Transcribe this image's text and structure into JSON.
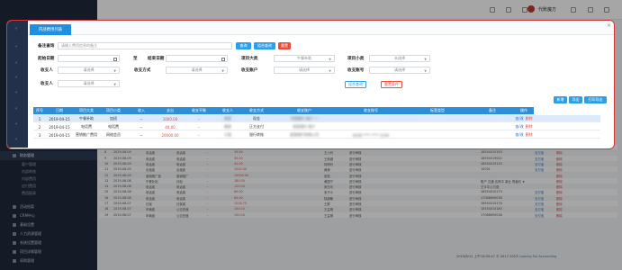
{
  "sidebar": {
    "section_title": "财务管理",
    "items": [
      {
        "label": "客户管理"
      },
      {
        "label": "内部转账"
      },
      {
        "label": "内部费用"
      },
      {
        "label": "应付费用"
      },
      {
        "label": "费用报表"
      }
    ],
    "groups": [
      {
        "label": "活动档案"
      },
      {
        "label": "CRM中心"
      },
      {
        "label": "基础设置"
      },
      {
        "label": "人力资源管理"
      },
      {
        "label": "系统设置管理"
      },
      {
        "label": "项目详情管理"
      },
      {
        "label": "采购管理"
      }
    ]
  },
  "topbar": {
    "user_name": "代账魔方"
  },
  "background_table": {
    "rows": [
      {
        "no": "7",
        "date": "2019-08-09",
        "type": "电话费",
        "item": "电话费",
        "amount": "-",
        "amount2": "32.00",
        "person": "李明",
        "status": "进行审核",
        "phone": "18554010239",
        "pay": "支付宝"
      },
      {
        "no": "8",
        "date": "2019-08-09",
        "type": "电话费",
        "item": "电话费",
        "amount": "-",
        "amount2": "39.89",
        "person": "王小玲",
        "status": "进行审核",
        "phone": "18554010193",
        "pay": "支付宝"
      },
      {
        "no": "9",
        "date": "2019-08-09",
        "type": "电话费",
        "item": "电话费",
        "amount": "-",
        "amount2": "30.00",
        "person": "王和健",
        "status": "进行审核",
        "phone": "18554019002",
        "pay": "支付宝"
      },
      {
        "no": "10",
        "date": "2019-08-09",
        "type": "电话费",
        "item": "电话费",
        "amount": "-",
        "amount2": "42.00",
        "person": "何琼玲",
        "status": "进行审核",
        "phone": "18554019133",
        "pay": "支付宝"
      },
      {
        "no": "11",
        "date": "2019-08-09",
        "type": "出租费",
        "item": "出租费",
        "amount": "-",
        "amount2": "1000.00",
        "person": "黄美",
        "status": "进行审核",
        "phone": "10031",
        "pay": "支付宝"
      },
      {
        "no": "12",
        "date": "2019-08-09",
        "type": "营销推广费",
        "item": "营销推广",
        "amount": "-",
        "amount2": "10000.00",
        "person": "张笑",
        "status": "进行审核",
        "phone": "",
        "pay": ""
      },
      {
        "no": "13",
        "date": "2019-08-08",
        "type": "午餐补贴",
        "item": "补贴",
        "amount": "-",
        "amount2": "180.00",
        "person": "黄国宁",
        "status": "进行审核",
        "phone": "账户 交通 名称中 事业 再营约 ★",
        "pay": ""
      },
      {
        "no": "14",
        "date": "2019-08-08",
        "type": "电话费",
        "item": "电话费",
        "amount": "-",
        "amount2": "120.00",
        "person": "张乐乐",
        "status": "进行审核",
        "phone": "王宇中心付费",
        "pay": ""
      },
      {
        "no": "15",
        "date": "2019-08-08",
        "type": "电话费",
        "item": "电话费",
        "amount": "-",
        "amount2": "60.00",
        "person": "宋子小",
        "status": "进行审核",
        "phone": "18554010179",
        "pay": "支付宝"
      },
      {
        "no": "16",
        "date": "2019-08-08",
        "type": "电话费",
        "item": "电话费",
        "amount": "-",
        "amount2": "60.00",
        "person": "陆超敏",
        "status": "进行审核",
        "phone": "17088690038",
        "pay": "支付宝"
      },
      {
        "no": "17",
        "date": "2019-08-07",
        "type": "社保",
        "item": "社保费",
        "amount": "-",
        "amount2": "1218.75",
        "person": "王群",
        "status": "进行审核",
        "phone": "18554010176",
        "pay": "支付宝"
      },
      {
        "no": "18",
        "date": "2019-08-07",
        "type": "车辆费",
        "item": "公交充值",
        "amount": "-",
        "amount2": "100.00",
        "person": "王益明",
        "status": "进行审核",
        "phone": "18554010180",
        "pay": "支付宝"
      },
      {
        "no": "19",
        "date": "2019-08-07",
        "type": "车辆费",
        "item": "公交充值",
        "amount": "-",
        "amount2": "100.00",
        "person": "王益明",
        "status": "进行审核",
        "phone": "17088690038",
        "pay": "支付宝"
      }
    ]
  },
  "footer": {
    "prefix": "2019/8/12 上午10:05:47 © 2017-2023 ",
    "highlight": "Looking For Accounting"
  },
  "dialog": {
    "tab_title": "内部费用列表",
    "close_glyph": "×",
    "search": {
      "label": "备注查询",
      "placeholder": "请输入费用信息的备注",
      "query_button": "查询",
      "combo_query_button": "组合查询",
      "reset_button": "重置"
    },
    "filters": {
      "start_date_label": "起始日期",
      "to_label": "至",
      "end_date_label": "结束日期",
      "category_label": "项目大类",
      "category_value": "午餐补助",
      "subcategory_label": "项目小类",
      "subcategory_value": "未选择",
      "payee_label": "收支人",
      "payee_value": "请选择",
      "method_label": "收支方式",
      "method_value": "请选择",
      "account_label": "收支账户",
      "account_value": "请选择",
      "account_no_label": "收支账号",
      "account_no_value": "请选择",
      "payer_label": "收支人",
      "payer_value": "请选择",
      "combo_query2": "组合查询",
      "clear_conditions": "重置条件"
    },
    "actions": {
      "add": "新增",
      "export": "导出",
      "print": "打印导出"
    },
    "table": {
      "headers": [
        "序号",
        "日期",
        "项目大类",
        "项目小类",
        "收入",
        "支出",
        "收支平衡",
        "收支人",
        "收支方式",
        "收支账户",
        "收支账号",
        "标签类型",
        "备注",
        "操作"
      ],
      "rows": [
        {
          "no": "1",
          "date": "2019-04-15",
          "category": "午餐补助",
          "sub": "加班",
          "income": "--",
          "expense": "1000.00",
          "balance": "-",
          "person": "周某",
          "method": "现金",
          "account": "中国银行 账户 一",
          "account_no": "",
          "tag": "",
          "note": "",
          "edit": "查/改",
          "del": "删除",
          "selected": true
        },
        {
          "no": "2",
          "date": "2019-04-15",
          "category": "电话费",
          "sub": "电话费",
          "income": "--",
          "expense": "40.00",
          "balance": "-",
          "person": "黄某",
          "method": "正方支付",
          "account": "某某银行 账户",
          "account_no": "",
          "tag": "",
          "note": "",
          "edit": "查/改",
          "del": "删除",
          "selected": false
        },
        {
          "no": "3",
          "date": "2019-04-15",
          "category": "营销推广费用",
          "sub": "网络会员",
          "income": "--",
          "expense": "20000.00",
          "balance": "-",
          "person": "王某",
          "method": "银行转账",
          "account": "某某银行有限公司",
          "account_no": "6228 **** **** 1234",
          "tag": "",
          "note": "",
          "edit": "查/改",
          "del": "删除",
          "selected": false
        }
      ]
    }
  }
}
